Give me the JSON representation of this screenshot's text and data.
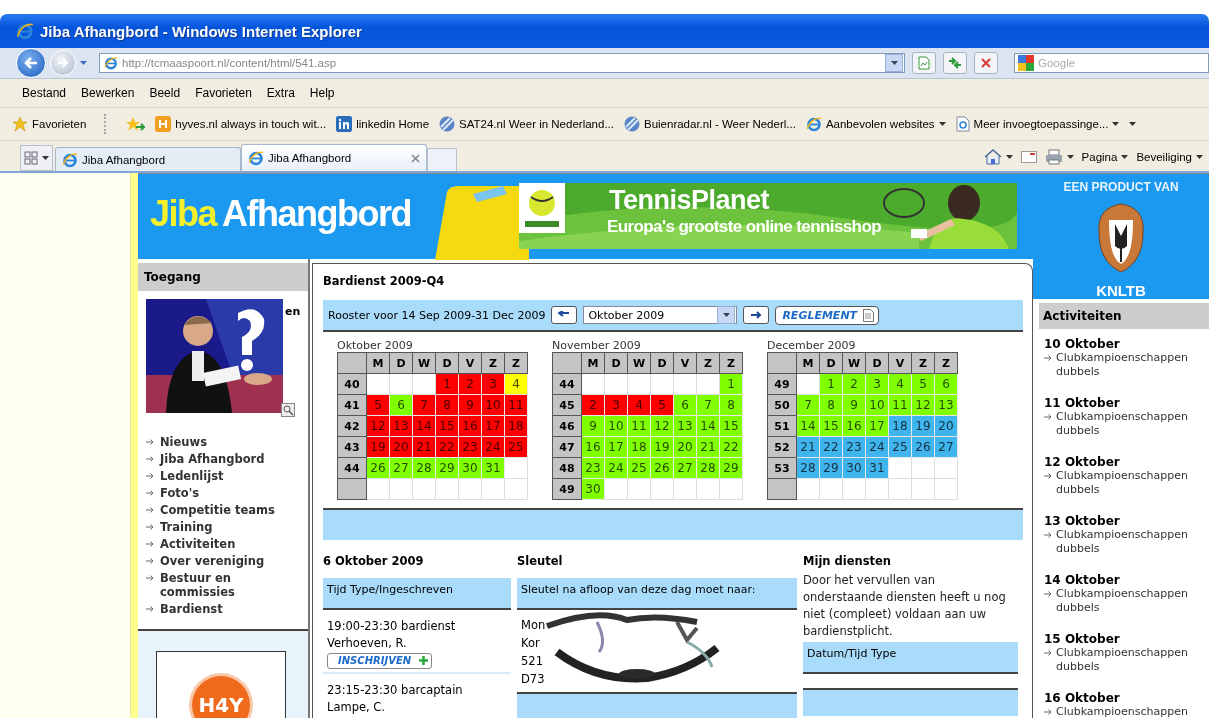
{
  "window": {
    "title": "Jiba Afhangbord - Windows Internet Explorer"
  },
  "address_bar": {
    "url": "http://tcmaaspoort.nl/content/html/541.asp"
  },
  "search": {
    "placeholder": "Google"
  },
  "menu": [
    "Bestand",
    "Bewerken",
    "Beeld",
    "Favorieten",
    "Extra",
    "Help"
  ],
  "favorites_bar": {
    "label": "Favorieten",
    "links": [
      {
        "label": "hyves.nl always in touch wit...",
        "kind": "hyves",
        "dropdown": false
      },
      {
        "label": "linkedin Home",
        "kind": "linkedin",
        "dropdown": false
      },
      {
        "label": "SAT24.nl Weer in Nederland...",
        "kind": "weather",
        "dropdown": false
      },
      {
        "label": "Buienradar.nl - Weer Nederl...",
        "kind": "weather",
        "dropdown": false
      },
      {
        "label": "Aanbevolen websites",
        "kind": "ie",
        "dropdown": true
      },
      {
        "label": "Meer invoegtoepassinge...",
        "kind": "page",
        "dropdown": true
      }
    ]
  },
  "tabs": [
    {
      "label": "Jiba Afhangbord",
      "selected": false
    },
    {
      "label": "Jiba Afhangbord",
      "selected": true
    }
  ],
  "command_bar": [
    "Pagina",
    "Beveiliging"
  ],
  "header": {
    "logo_first": "Jiba",
    "logo_second": "Afhangbord",
    "banner_title": "TennisPlanet",
    "banner_subtitle": "Europa's grootste online tennisshop"
  },
  "sponsor": {
    "caption": "EEN PRODUCT VAN",
    "name": "KNLTB"
  },
  "sidebar": {
    "title": "Toegang",
    "photo_text": "en",
    "nav": [
      "Nieuws",
      "Jiba Afhangbord",
      "Ledenlijst",
      "Foto's",
      "Competitie teams",
      "Training",
      "Activiteiten",
      "Over vereniging",
      "Bestuur en commissies",
      "Bardienst"
    ],
    "partner_logo": "H4Y"
  },
  "bardienst": {
    "title": "Bardienst 2009-Q4",
    "range": "Rooster voor 14 Sep 2009-31 Dec 2009",
    "month_select": "Oktober 2009",
    "rules_button": "REGLEMENT",
    "months": [
      {
        "name": "Oktober 2009",
        "weekdays": [
          "M",
          "D",
          "W",
          "D",
          "V",
          "Z",
          "Z"
        ],
        "weeks": [
          {
            "week": "40",
            "days": [
              {
                "kind": "blank"
              },
              {
                "kind": "blank"
              },
              {
                "kind": "blank"
              },
              {
                "kind": "day",
                "day": "1",
                "color": "#ff0000"
              },
              {
                "kind": "day",
                "day": "2",
                "color": "#ff0000"
              },
              {
                "kind": "day",
                "day": "3",
                "color": "#ff0000"
              },
              {
                "kind": "day",
                "day": "4",
                "color": "#ffff00"
              }
            ]
          },
          {
            "week": "41",
            "days": [
              {
                "kind": "day",
                "day": "5",
                "color": "#ff0000"
              },
              {
                "kind": "day",
                "day": "6",
                "color": "#80ff00"
              },
              {
                "kind": "day",
                "day": "7",
                "color": "#ff0000"
              },
              {
                "kind": "day",
                "day": "8",
                "color": "#ff0000"
              },
              {
                "kind": "day",
                "day": "9",
                "color": "#ff0000"
              },
              {
                "kind": "day",
                "day": "10",
                "color": "#ff0000"
              },
              {
                "kind": "day",
                "day": "11",
                "color": "#ff0000"
              }
            ]
          },
          {
            "week": "42",
            "days": [
              {
                "kind": "day",
                "day": "12",
                "color": "#ff0000"
              },
              {
                "kind": "day",
                "day": "13",
                "color": "#ff0000"
              },
              {
                "kind": "day",
                "day": "14",
                "color": "#ff0000"
              },
              {
                "kind": "day",
                "day": "15",
                "color": "#ff0000"
              },
              {
                "kind": "day",
                "day": "16",
                "color": "#ff0000"
              },
              {
                "kind": "day",
                "day": "17",
                "color": "#ff0000"
              },
              {
                "kind": "day",
                "day": "18",
                "color": "#ff0000"
              }
            ]
          },
          {
            "week": "43",
            "days": [
              {
                "kind": "day",
                "day": "19",
                "color": "#ff0000"
              },
              {
                "kind": "day",
                "day": "20",
                "color": "#ff0000"
              },
              {
                "kind": "day",
                "day": "21",
                "color": "#ff0000"
              },
              {
                "kind": "day",
                "day": "22",
                "color": "#ff0000"
              },
              {
                "kind": "day",
                "day": "23",
                "color": "#ff0000"
              },
              {
                "kind": "day",
                "day": "24",
                "color": "#ff0000"
              },
              {
                "kind": "day",
                "day": "25",
                "color": "#ff0000"
              }
            ]
          },
          {
            "week": "44",
            "days": [
              {
                "kind": "day",
                "day": "26",
                "color": "#80ff00"
              },
              {
                "kind": "day",
                "day": "27",
                "color": "#80ff00"
              },
              {
                "kind": "day",
                "day": "28",
                "color": "#80ff00"
              },
              {
                "kind": "day",
                "day": "29",
                "color": "#80ff00"
              },
              {
                "kind": "day",
                "day": "30",
                "color": "#80ff00"
              },
              {
                "kind": "day",
                "day": "31",
                "color": "#80ff00"
              },
              {
                "kind": "blank"
              }
            ]
          },
          {
            "days": [
              {
                "kind": "blank"
              },
              {
                "kind": "blank"
              },
              {
                "kind": "blank"
              },
              {
                "kind": "blank"
              },
              {
                "kind": "blank"
              },
              {
                "kind": "blank"
              },
              {
                "kind": "blank"
              }
            ]
          }
        ]
      },
      {
        "name": "November 2009",
        "weekdays": [
          "M",
          "D",
          "W",
          "D",
          "V",
          "Z",
          "Z"
        ],
        "weeks": [
          {
            "week": "44",
            "days": [
              {
                "kind": "blank"
              },
              {
                "kind": "blank"
              },
              {
                "kind": "blank"
              },
              {
                "kind": "blank"
              },
              {
                "kind": "blank"
              },
              {
                "kind": "blank"
              },
              {
                "kind": "day",
                "day": "1",
                "color": "#80ff00"
              }
            ]
          },
          {
            "week": "45",
            "days": [
              {
                "kind": "day",
                "day": "2",
                "color": "#ff0000"
              },
              {
                "kind": "day",
                "day": "3",
                "color": "#ff0000"
              },
              {
                "kind": "day",
                "day": "4",
                "color": "#ff0000"
              },
              {
                "kind": "day",
                "day": "5",
                "color": "#ff0000"
              },
              {
                "kind": "day",
                "day": "6",
                "color": "#80ff00"
              },
              {
                "kind": "day",
                "day": "7",
                "color": "#80ff00"
              },
              {
                "kind": "day",
                "day": "8",
                "color": "#80ff00"
              }
            ]
          },
          {
            "week": "46",
            "days": [
              {
                "kind": "day",
                "day": "9",
                "color": "#80ff00"
              },
              {
                "kind": "day",
                "day": "10",
                "color": "#80ff00"
              },
              {
                "kind": "day",
                "day": "11",
                "color": "#80ff00"
              },
              {
                "kind": "day",
                "day": "12",
                "color": "#80ff00"
              },
              {
                "kind": "day",
                "day": "13",
                "color": "#80ff00"
              },
              {
                "kind": "day",
                "day": "14",
                "color": "#80ff00"
              },
              {
                "kind": "day",
                "day": "15",
                "color": "#80ff00"
              }
            ]
          },
          {
            "week": "47",
            "days": [
              {
                "kind": "day",
                "day": "16",
                "color": "#80ff00"
              },
              {
                "kind": "day",
                "day": "17",
                "color": "#80ff00"
              },
              {
                "kind": "day",
                "day": "18",
                "color": "#80ff00"
              },
              {
                "kind": "day",
                "day": "19",
                "color": "#80ff00"
              },
              {
                "kind": "day",
                "day": "20",
                "color": "#80ff00"
              },
              {
                "kind": "day",
                "day": "21",
                "color": "#80ff00"
              },
              {
                "kind": "day",
                "day": "22",
                "color": "#80ff00"
              }
            ]
          },
          {
            "week": "48",
            "days": [
              {
                "kind": "day",
                "day": "23",
                "color": "#80ff00"
              },
              {
                "kind": "day",
                "day": "24",
                "color": "#80ff00"
              },
              {
                "kind": "day",
                "day": "25",
                "color": "#80ff00"
              },
              {
                "kind": "day",
                "day": "26",
                "color": "#80ff00"
              },
              {
                "kind": "day",
                "day": "27",
                "color": "#80ff00"
              },
              {
                "kind": "day",
                "day": "28",
                "color": "#80ff00"
              },
              {
                "kind": "day",
                "day": "29",
                "color": "#80ff00"
              }
            ]
          },
          {
            "week": "49",
            "days": [
              {
                "kind": "day",
                "day": "30",
                "color": "#80ff00"
              },
              {
                "kind": "blank"
              },
              {
                "kind": "blank"
              },
              {
                "kind": "blank"
              },
              {
                "kind": "blank"
              },
              {
                "kind": "blank"
              },
              {
                "kind": "blank"
              }
            ]
          }
        ]
      },
      {
        "name": "December 2009",
        "weekdays": [
          "M",
          "D",
          "W",
          "D",
          "V",
          "Z",
          "Z"
        ],
        "weeks": [
          {
            "week": "49",
            "days": [
              {
                "kind": "blank"
              },
              {
                "kind": "day",
                "day": "1",
                "color": "#80ff00"
              },
              {
                "kind": "day",
                "day": "2",
                "color": "#80ff00"
              },
              {
                "kind": "day",
                "day": "3",
                "color": "#80ff00"
              },
              {
                "kind": "day",
                "day": "4",
                "color": "#80ff00"
              },
              {
                "kind": "day",
                "day": "5",
                "color": "#80ff00"
              },
              {
                "kind": "day",
                "day": "6",
                "color": "#80ff00"
              }
            ]
          },
          {
            "week": "50",
            "days": [
              {
                "kind": "day",
                "day": "7",
                "color": "#80ff00"
              },
              {
                "kind": "day",
                "day": "8",
                "color": "#80ff00"
              },
              {
                "kind": "day",
                "day": "9",
                "color": "#80ff00"
              },
              {
                "kind": "day",
                "day": "10",
                "color": "#80ff00"
              },
              {
                "kind": "day",
                "day": "11",
                "color": "#80ff00"
              },
              {
                "kind": "day",
                "day": "12",
                "color": "#80ff00"
              },
              {
                "kind": "day",
                "day": "13",
                "color": "#80ff00"
              }
            ]
          },
          {
            "week": "51",
            "days": [
              {
                "kind": "day",
                "day": "14",
                "color": "#80ff00"
              },
              {
                "kind": "day",
                "day": "15",
                "color": "#80ff00"
              },
              {
                "kind": "day",
                "day": "16",
                "color": "#80ff00"
              },
              {
                "kind": "day",
                "day": "17",
                "color": "#80ff00"
              },
              {
                "kind": "day",
                "day": "18",
                "color": "#40b4ec"
              },
              {
                "kind": "day",
                "day": "19",
                "color": "#40b4ec"
              },
              {
                "kind": "day",
                "day": "20",
                "color": "#40b4ec"
              }
            ]
          },
          {
            "week": "52",
            "days": [
              {
                "kind": "day",
                "day": "21",
                "color": "#40b4ec"
              },
              {
                "kind": "day",
                "day": "22",
                "color": "#40b4ec"
              },
              {
                "kind": "day",
                "day": "23",
                "color": "#40b4ec"
              },
              {
                "kind": "day",
                "day": "24",
                "color": "#40b4ec"
              },
              {
                "kind": "day",
                "day": "25",
                "color": "#40b4ec"
              },
              {
                "kind": "day",
                "day": "26",
                "color": "#40b4ec"
              },
              {
                "kind": "day",
                "day": "27",
                "color": "#40b4ec"
              }
            ]
          },
          {
            "week": "53",
            "days": [
              {
                "kind": "day",
                "day": "28",
                "color": "#40b4ec"
              },
              {
                "kind": "day",
                "day": "29",
                "color": "#40b4ec"
              },
              {
                "kind": "day",
                "day": "30",
                "color": "#40b4ec"
              },
              {
                "kind": "day",
                "day": "31",
                "color": "#40b4ec"
              },
              {
                "kind": "blank"
              },
              {
                "kind": "blank"
              },
              {
                "kind": "blank"
              }
            ]
          },
          {
            "days": [
              {
                "kind": "blank"
              },
              {
                "kind": "blank"
              },
              {
                "kind": "blank"
              },
              {
                "kind": "blank"
              },
              {
                "kind": "blank"
              },
              {
                "kind": "blank"
              },
              {
                "kind": "blank"
              }
            ]
          }
        ]
      }
    ]
  },
  "day_schedule": {
    "title": "6 Oktober 2009",
    "header": "Tijd Type/Ingeschreven",
    "entries": [
      {
        "shift": "19:00-23:30 bardienst",
        "name": "Verhoeven, R.",
        "button": "INSCHRIJVEN"
      },
      {
        "shift": "23:15-23:30 barcaptain",
        "name": "Lampe, C."
      }
    ]
  },
  "key": {
    "title": "Sleutel",
    "header": "Sleutel na afloop van deze dag moet naar:",
    "lines": [
      "Mon",
      "Kor",
      "521",
      "D73"
    ]
  },
  "my_duties": {
    "title": "Mijn diensten",
    "notice": "Door het vervullen van onderstaande diensten heeft u nog niet (compleet) voldaan aan uw bardienstplicht.",
    "header": "Datum/Tijd Type"
  },
  "activities": {
    "title": "Activiteiten",
    "items": [
      {
        "date": "10 Oktober",
        "name": "Clubkampioenschappen dubbels"
      },
      {
        "date": "11 Oktober",
        "name": "Clubkampioenschappen dubbels"
      },
      {
        "date": "12 Oktober",
        "name": "Clubkampioenschappen dubbels"
      },
      {
        "date": "13 Oktober",
        "name": "Clubkampioenschappen dubbels"
      },
      {
        "date": "14 Oktober",
        "name": "Clubkampioenschappen dubbels"
      },
      {
        "date": "15 Oktober",
        "name": "Clubkampioenschappen dubbels"
      },
      {
        "date": "16 Oktober",
        "name": "Clubkampioenschappen"
      }
    ]
  }
}
